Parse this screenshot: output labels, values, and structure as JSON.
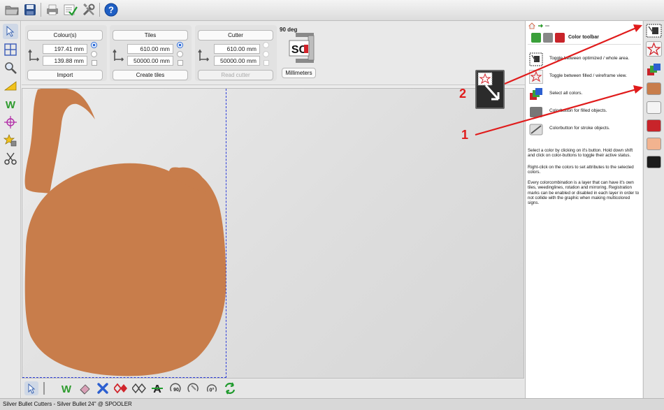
{
  "top_toolbar": {
    "icons": [
      "open-folder-icon",
      "save-icon",
      "print-icon",
      "checklist-icon",
      "tools-icon",
      "help-icon"
    ]
  },
  "left_toolbar": {
    "icons": [
      "select-arrow-icon",
      "grid-icon",
      "zoom-icon",
      "eraser-icon",
      "weed-icon",
      "registration-target-icon",
      "star-tool-icon",
      "scissors-icon"
    ]
  },
  "options": {
    "colours": {
      "header": "Colour(s)",
      "width": "197.41 mm",
      "height": "139.88 mm",
      "button": "Import"
    },
    "tiles": {
      "header": "Tiles",
      "width": "610.00 mm",
      "height": "50000.00 mm",
      "button": "Create tiles"
    },
    "cutter": {
      "header": "Cutter",
      "width": "610.00 mm",
      "height": "50000.00 mm",
      "button": "Read cutter"
    },
    "rotation_label": "90 deg",
    "logo_text": "SC",
    "units_button": "Millimeters"
  },
  "bottom_toolbar": {
    "icons": [
      "pointer-icon",
      "divider",
      "weed-icon",
      "eraser-icon",
      "delete-x-icon",
      "diamond-red-icon",
      "diamond-outline-icon",
      "text-strike-icon",
      "rotate-90-icon",
      "rotate-ccw-icon",
      "rotate-0-icon",
      "refresh-icon"
    ],
    "rotate_90_label": "90",
    "rotate_0_label": "0°"
  },
  "status_bar": {
    "text": "Silver Bullet Cutters - Silver Bullet 24\" @ SPOOLER"
  },
  "help_panel": {
    "title": "Color toolbar",
    "rows": [
      {
        "icon": "toggle-area-icon",
        "text": "Toggle between optimized / whole area."
      },
      {
        "icon": "star-outline-icon",
        "text": "Toggle between filled / wireframe view."
      },
      {
        "icon": "select-all-colors-icon",
        "text": "Select all colors."
      },
      {
        "icon": "fill-color-button-icon",
        "text": "Colorbutton for filled objects."
      },
      {
        "icon": "stroke-color-button-icon",
        "text": "Colorbutton for stroke objects."
      }
    ],
    "paragraphs": [
      "Select a color by clicking on it's button. Hold down shift and click on color-buttons to toggle their active status.",
      "Right-click on the colors to set attributes to the selected colors.",
      "Every colorcombination is a layer that can have it's own tiles, weedinglines, rotation and mirroring. Registration marks can be enabled or disabled in each layer in order to not collide with the graphic when making multicolored signs."
    ]
  },
  "color_toolbar": {
    "swatches": [
      "#c87d4b",
      "#f4f4f4",
      "#c8242a",
      "#f2b38f",
      "#1c1c1c"
    ]
  },
  "annotations": {
    "label_1": "1",
    "label_2": "2"
  },
  "colors": {
    "shape_fill": "#c87d4b",
    "page_border": "#2b3bd9",
    "arrow": "#e01b1b"
  }
}
